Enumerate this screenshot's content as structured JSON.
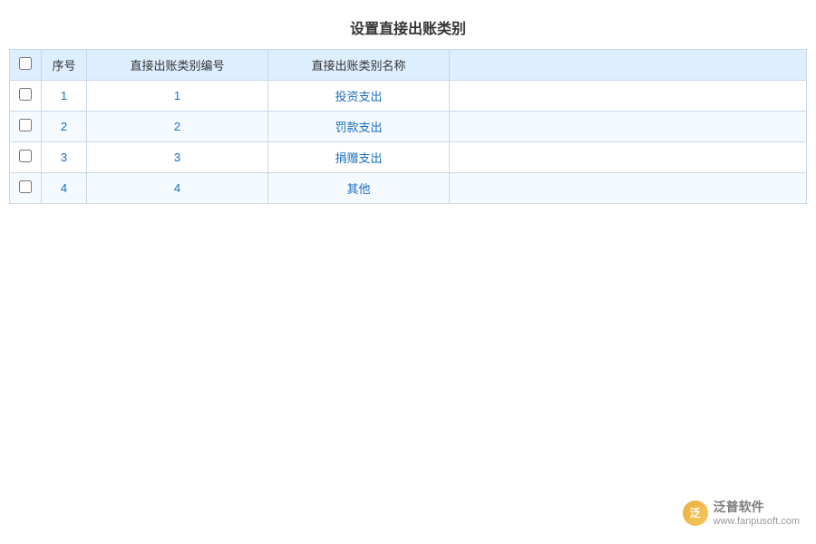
{
  "title": "设置直接出账类别",
  "table": {
    "headers": {
      "checkbox": "",
      "seq": "序号",
      "code": "直接出账类别编号",
      "name": "直接出账类别名称",
      "extra": ""
    },
    "rows": [
      {
        "seq": "1",
        "code": "1",
        "name": "投资支出"
      },
      {
        "seq": "2",
        "code": "2",
        "name": "罚款支出"
      },
      {
        "seq": "3",
        "code": "3",
        "name": "捐赠支出"
      },
      {
        "seq": "4",
        "code": "4",
        "name": "其他"
      }
    ]
  },
  "watermark": {
    "logo_text": "泛",
    "brand": "泛普软件",
    "url": "www.fanpusoft.com"
  }
}
